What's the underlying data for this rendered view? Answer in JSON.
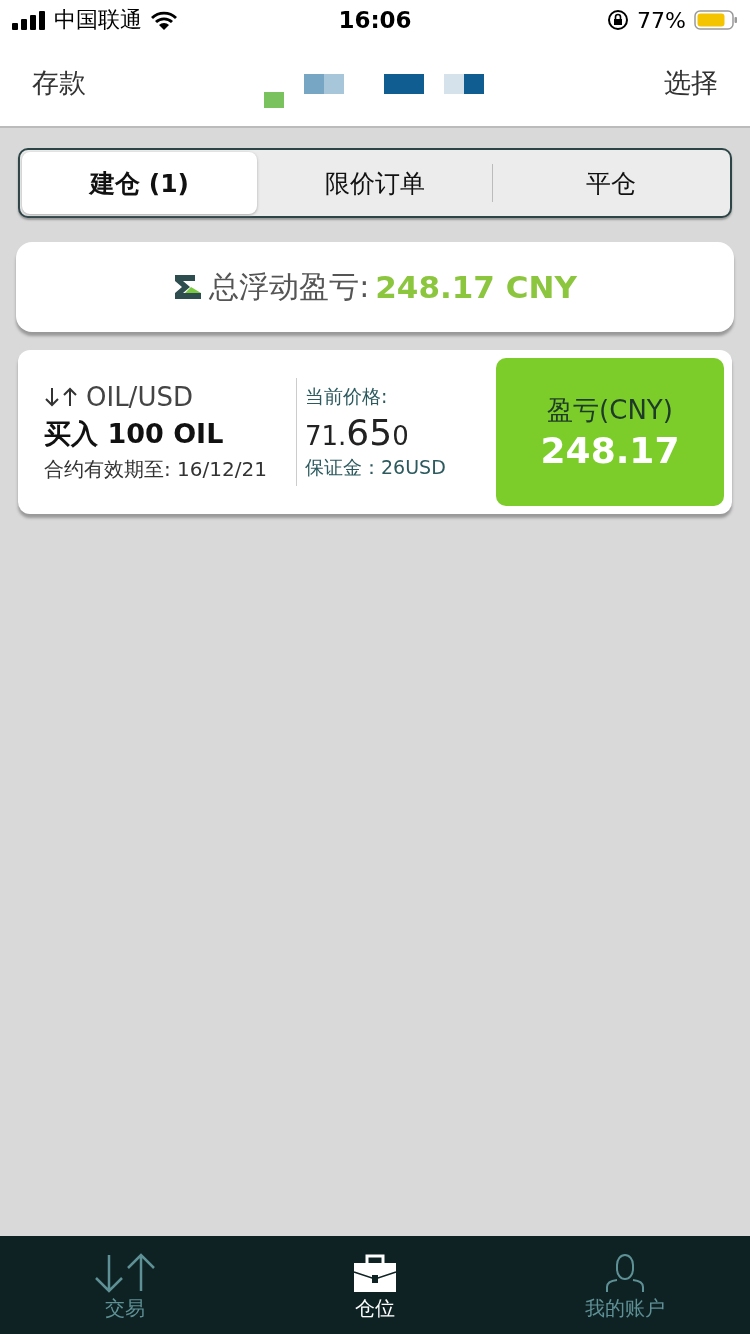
{
  "status_bar": {
    "carrier": "中国联通",
    "time": "16:06",
    "battery": "77%"
  },
  "header": {
    "left": "存款",
    "right": "选择"
  },
  "tabs": [
    {
      "label": "建仓 (1)",
      "selected": true
    },
    {
      "label": "限价订单",
      "selected": false
    },
    {
      "label": "平仓",
      "selected": false
    }
  ],
  "summary": {
    "label": "总浮动盈亏:",
    "value": "248.17 CNY"
  },
  "positions": [
    {
      "symbol": "OIL/USD",
      "action": "买入 100 OIL",
      "expiry": "合约有效期至: 16/12/21",
      "price_label": "当前价格:",
      "price_lead": "71.",
      "price_big": "65",
      "price_tail": "0",
      "margin": "保证金：26USD",
      "pl_label": "盈亏(CNY)",
      "pl_value": "248.17"
    }
  ],
  "bottom_nav": [
    {
      "kind": "trade",
      "label": "交易",
      "selected": false
    },
    {
      "kind": "positions",
      "label": "仓位",
      "selected": true
    },
    {
      "kind": "account",
      "label": "我的账户",
      "selected": false
    }
  ]
}
